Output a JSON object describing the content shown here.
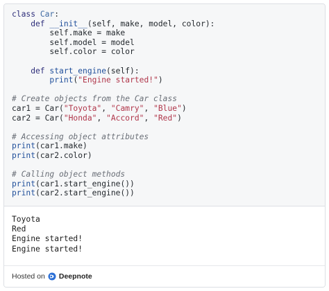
{
  "code": {
    "lines": [
      [
        {
          "t": "class ",
          "c": "kw"
        },
        {
          "t": "Car",
          "c": "cls"
        },
        {
          "t": ":",
          "c": ""
        }
      ],
      [
        {
          "t": "    def ",
          "c": "kw"
        },
        {
          "t": "__init__",
          "c": "fn"
        },
        {
          "t": "(self, make, model, color):",
          "c": ""
        }
      ],
      [
        {
          "t": "        self.make = make",
          "c": ""
        }
      ],
      [
        {
          "t": "        self.model = model",
          "c": ""
        }
      ],
      [
        {
          "t": "        self.color = color",
          "c": ""
        }
      ],
      [
        {
          "t": "",
          "c": ""
        }
      ],
      [
        {
          "t": "    def ",
          "c": "kw"
        },
        {
          "t": "start_engine",
          "c": "fn"
        },
        {
          "t": "(self):",
          "c": ""
        }
      ],
      [
        {
          "t": "        ",
          "c": ""
        },
        {
          "t": "print",
          "c": "fn"
        },
        {
          "t": "(",
          "c": ""
        },
        {
          "t": "\"Engine started!\"",
          "c": "str"
        },
        {
          "t": ")",
          "c": ""
        }
      ],
      [
        {
          "t": "",
          "c": ""
        }
      ],
      [
        {
          "t": "# Create objects from the Car class",
          "c": "cmt"
        }
      ],
      [
        {
          "t": "car1 = Car(",
          "c": ""
        },
        {
          "t": "\"Toyota\"",
          "c": "str"
        },
        {
          "t": ", ",
          "c": ""
        },
        {
          "t": "\"Camry\"",
          "c": "str"
        },
        {
          "t": ", ",
          "c": ""
        },
        {
          "t": "\"Blue\"",
          "c": "str"
        },
        {
          "t": ")",
          "c": ""
        }
      ],
      [
        {
          "t": "car2 = Car(",
          "c": ""
        },
        {
          "t": "\"Honda\"",
          "c": "str"
        },
        {
          "t": ", ",
          "c": ""
        },
        {
          "t": "\"Accord\"",
          "c": "str"
        },
        {
          "t": ", ",
          "c": ""
        },
        {
          "t": "\"Red\"",
          "c": "str"
        },
        {
          "t": ")",
          "c": ""
        }
      ],
      [
        {
          "t": "",
          "c": ""
        }
      ],
      [
        {
          "t": "# Accessing object attributes",
          "c": "cmt"
        }
      ],
      [
        {
          "t": "print",
          "c": "fn"
        },
        {
          "t": "(car1.make)",
          "c": ""
        }
      ],
      [
        {
          "t": "print",
          "c": "fn"
        },
        {
          "t": "(car2.color)",
          "c": ""
        }
      ],
      [
        {
          "t": "",
          "c": ""
        }
      ],
      [
        {
          "t": "# Calling object methods",
          "c": "cmt"
        }
      ],
      [
        {
          "t": "print",
          "c": "fn"
        },
        {
          "t": "(car1.start_engine())",
          "c": ""
        }
      ],
      [
        {
          "t": "print",
          "c": "fn"
        },
        {
          "t": "(car2.start_engine())",
          "c": ""
        }
      ]
    ]
  },
  "output": {
    "lines": [
      "Toyota",
      "Red",
      "Engine started!",
      "Engine started!"
    ]
  },
  "footer": {
    "prefix": "Hosted on",
    "brand": "Deepnote",
    "logo_icon": "deepnote-logo-icon"
  }
}
